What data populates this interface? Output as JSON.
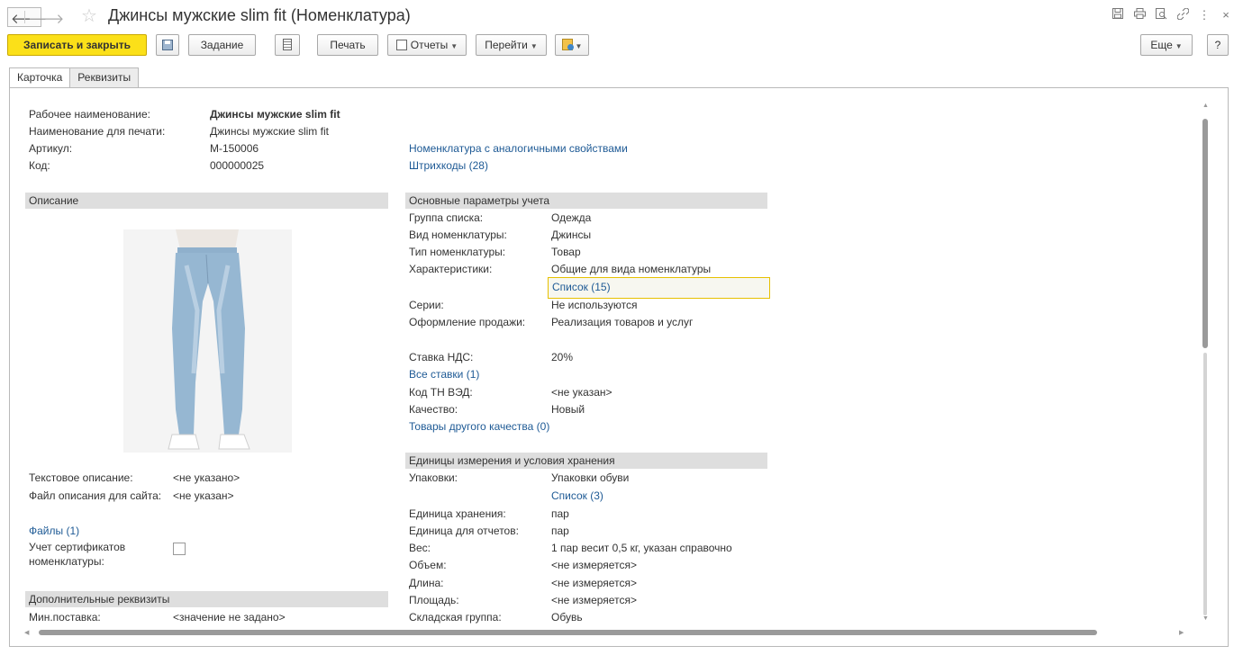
{
  "window": {
    "title": "Джинсы мужские slim fit (Номенклатура)",
    "more_icon": "⋮",
    "close_icon": "×"
  },
  "toolbar": {
    "save_close": "Записать и закрыть",
    "task": "Задание",
    "print": "Печать",
    "reports": "Отчеты",
    "goto": "Перейти",
    "more": "Еще",
    "help": "?"
  },
  "tabs": [
    "Карточка",
    "Реквизиты"
  ],
  "left": {
    "rows": [
      {
        "label": "Рабочее наименование:",
        "value": "Джинсы мужские slim fit"
      },
      {
        "label": "Наименование для печати:",
        "value": "Джинсы мужские slim fit"
      },
      {
        "label": "Артикул:",
        "value": "М-150006"
      },
      {
        "label": "Код:",
        "value": "000000025"
      }
    ],
    "description_header": "Описание",
    "text_desc_label": "Текстовое описание:",
    "text_desc_value": "<не указано>",
    "file_desc_label": "Файл описания для сайта:",
    "file_desc_value": "<не указан>",
    "files_link": "Файлы (1)",
    "cert_label_1": "Учет сертификатов",
    "cert_label_2": "номенклатуры:",
    "extra_header": "Дополнительные реквизиты",
    "min_supply_label": "Мин.поставка:",
    "min_supply_value": "<значение не задано>"
  },
  "links_top": {
    "analog": "Номенклатура с аналогичными свойствами",
    "barcodes": "Штрихкоды (28)"
  },
  "accounting": {
    "header": "Основные параметры учета",
    "group_label": "Группа списка:",
    "group_value": "Одежда",
    "kind_label": "Вид номенклатуры:",
    "kind_value": "Джинсы",
    "type_label": "Тип номенклатуры:",
    "type_value": "Товар",
    "char_label": "Характеристики:",
    "char_value": "Общие для вида номенклатуры",
    "char_list": "Список (15)",
    "series_label": "Серии:",
    "series_value": "Не используются",
    "sale_label": "Оформление продажи:",
    "sale_value": "Реализация товаров и услуг",
    "vat_label": "Ставка НДС:",
    "vat_value": "20%",
    "all_rates": "Все ставки (1)",
    "tnved_label": "Код ТН ВЭД:",
    "tnved_value": "<не указан>",
    "quality_label": "Качество:",
    "quality_value": "Новый",
    "other_quality": "Товары другого качества (0)"
  },
  "units": {
    "header": "Единицы измерения и условия хранения",
    "pack_label": "Упаковки:",
    "pack_value": "Упаковки обуви",
    "pack_list": "Список (3)",
    "store_label": "Единица хранения:",
    "store_value": "пар",
    "report_label": "Единица для отчетов:",
    "report_value": "пар",
    "weight_label": "Вес:",
    "weight_value": "1 пар весит 0,5 кг, указан справочно",
    "volume_label": "Объем:",
    "volume_value": "<не измеряется>",
    "length_label": "Длина:",
    "length_value": "<не измеряется>",
    "area_label": "Площадь:",
    "area_value": "<не измеряется>",
    "wh_label": "Складская группа:",
    "wh_value": "Обувь"
  }
}
